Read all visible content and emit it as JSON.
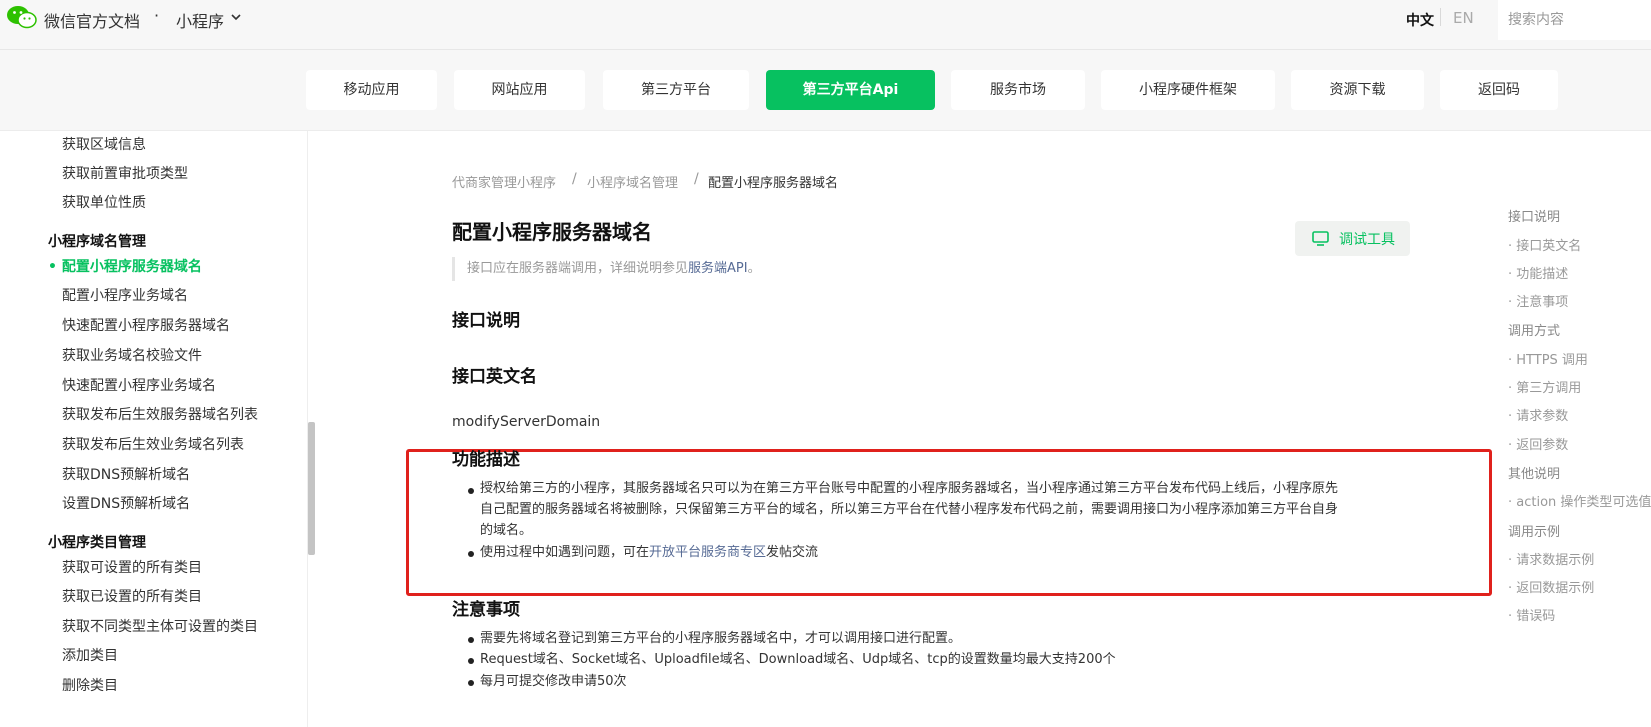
{
  "header": {
    "brand": "微信官方文档",
    "dot": "·",
    "product": "小程序",
    "lang_zh": "中文",
    "lang_en": "EN",
    "search_placeholder": "搜索内容"
  },
  "tabs": [
    {
      "label": "移动应用",
      "active": false
    },
    {
      "label": "网站应用",
      "active": false
    },
    {
      "label": "第三方平台",
      "active": false
    },
    {
      "label": "第三方平台Api",
      "active": true
    },
    {
      "label": "服务市场",
      "active": false
    },
    {
      "label": "小程序硬件框架",
      "active": false
    },
    {
      "label": "资源下载",
      "active": false
    },
    {
      "label": "返回码",
      "active": false
    }
  ],
  "sidebar": {
    "items_top": [
      "获取区域信息",
      "获取前置审批项类型",
      "获取单位性质"
    ],
    "group1": "小程序域名管理",
    "active_item": "配置小程序服务器域名",
    "items_group1": [
      "配置小程序业务域名",
      "快速配置小程序服务器域名",
      "获取业务域名校验文件",
      "快速配置小程序业务域名",
      "获取发布后生效服务器域名列表",
      "获取发布后生效业务域名列表",
      "获取DNS预解析域名",
      "设置DNS预解析域名"
    ],
    "group2": "小程序类目管理",
    "items_group2": [
      "获取可设置的所有类目",
      "获取已设置的所有类目",
      "获取不同类型主体可设置的类目",
      "添加类目",
      "删除类目"
    ]
  },
  "breadcrumb": [
    "代商家管理小程序",
    "小程序域名管理",
    "配置小程序服务器域名"
  ],
  "breadcrumb_sep": "/",
  "main": {
    "title": "配置小程序服务器域名",
    "debug_button": "调试工具",
    "note_prefix": "接口应在服务器端调用，详细说明参见",
    "note_link": "服务端API",
    "note_suffix": "。",
    "section_interface": "接口说明",
    "section_en_name": "接口英文名",
    "en_name": "modifyServerDomain",
    "section_func": "功能描述",
    "func_p1_line1": "授权给第三方的小程序，其服务器域名只可以为在第三方平台账号中配置的小程序服务器域名，当小程序通过第三方平台发布代码上线后，小程序原先",
    "func_p1_line2": "自己配置的服务器域名将被删除，只保留第三方平台的域名，所以第三方平台在代替小程序发布代码之前，需要调用接口为小程序添加第三方平台自身",
    "func_p1_line3": "的域名。",
    "func_p2_prefix": "使用过程中如遇到问题，可在",
    "func_p2_link": "开放平台服务商专区",
    "func_p2_suffix": "发帖交流",
    "section_notes": "注意事项",
    "notes": [
      "需要先将域名登记到第三方平台的小程序服务器域名中，才可以调用接口进行配置。",
      "Request域名、Socket域名、Uploadfile域名、Download域名、Udp域名、tcp的设置数量均最大支持200个",
      "每月可提交修改申请50次"
    ]
  },
  "toc": [
    {
      "label": "接口说明",
      "sub": false
    },
    {
      "label": "· 接口英文名",
      "sub": true
    },
    {
      "label": "· 功能描述",
      "sub": true
    },
    {
      "label": "· 注意事项",
      "sub": true
    },
    {
      "label": "调用方式",
      "sub": false
    },
    {
      "label": "· HTTPS 调用",
      "sub": true
    },
    {
      "label": "· 第三方调用",
      "sub": true
    },
    {
      "label": "· 请求参数",
      "sub": true
    },
    {
      "label": "· 返回参数",
      "sub": true
    },
    {
      "label": "其他说明",
      "sub": false
    },
    {
      "label": "· action 操作类型可选值",
      "sub": true
    },
    {
      "label": "调用示例",
      "sub": false
    },
    {
      "label": "· 请求数据示例",
      "sub": true
    },
    {
      "label": "· 返回数据示例",
      "sub": true
    },
    {
      "label": "· 错误码",
      "sub": true
    }
  ],
  "colors": {
    "accent": "#07c160",
    "link": "#576b95",
    "highlight_border": "#e0211c"
  }
}
